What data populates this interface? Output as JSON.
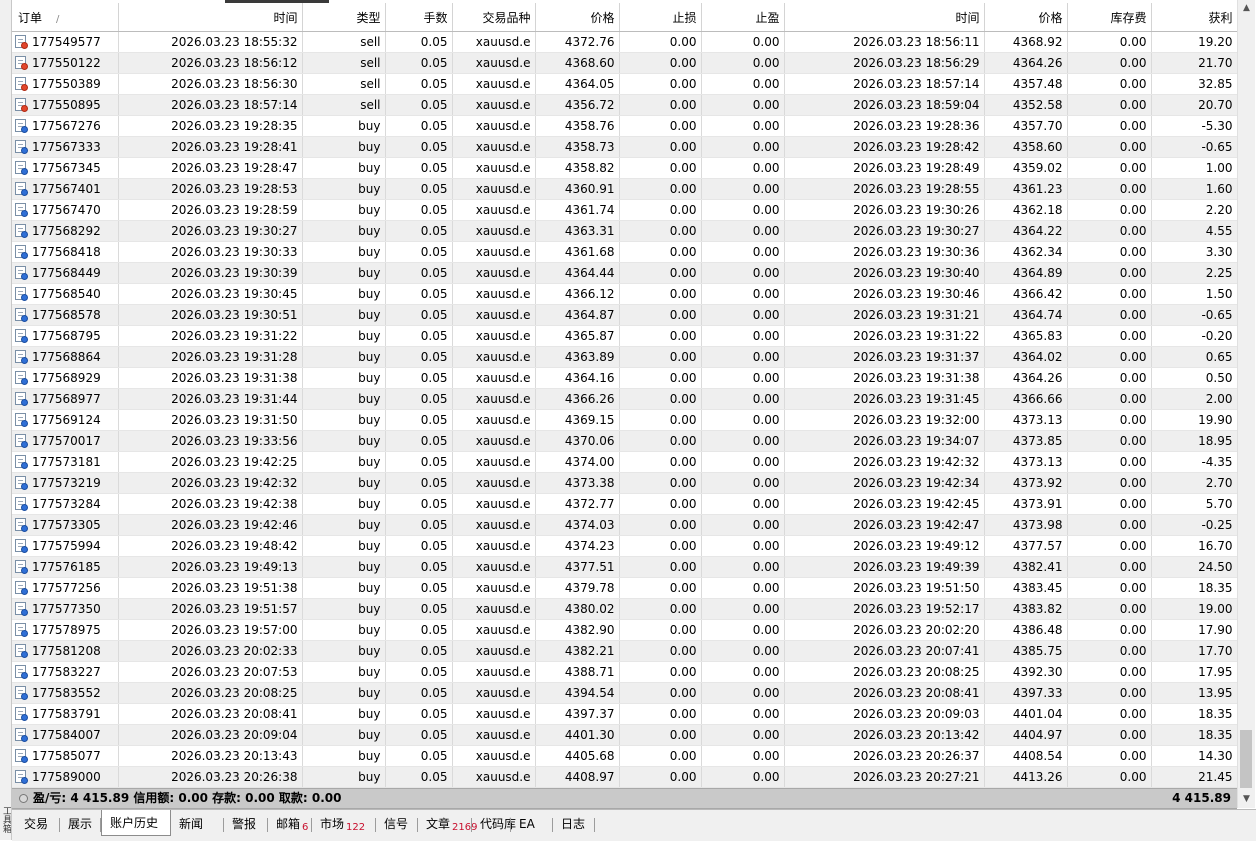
{
  "columns": [
    "订单",
    "时间",
    "类型",
    "手数",
    "交易品种",
    "价格",
    "止损",
    "止盈",
    "时间",
    "价格",
    "库存费",
    "获利"
  ],
  "sort_indicator": "/",
  "rows": [
    [
      "177549577",
      "2026.03.23 18:55:32",
      "sell",
      "0.05",
      "xauusd.e",
      "4372.76",
      "0.00",
      "0.00",
      "2026.03.23 18:56:11",
      "4368.92",
      "0.00",
      "19.20"
    ],
    [
      "177550122",
      "2026.03.23 18:56:12",
      "sell",
      "0.05",
      "xauusd.e",
      "4368.60",
      "0.00",
      "0.00",
      "2026.03.23 18:56:29",
      "4364.26",
      "0.00",
      "21.70"
    ],
    [
      "177550389",
      "2026.03.23 18:56:30",
      "sell",
      "0.05",
      "xauusd.e",
      "4364.05",
      "0.00",
      "0.00",
      "2026.03.23 18:57:14",
      "4357.48",
      "0.00",
      "32.85"
    ],
    [
      "177550895",
      "2026.03.23 18:57:14",
      "sell",
      "0.05",
      "xauusd.e",
      "4356.72",
      "0.00",
      "0.00",
      "2026.03.23 18:59:04",
      "4352.58",
      "0.00",
      "20.70"
    ],
    [
      "177567276",
      "2026.03.23 19:28:35",
      "buy",
      "0.05",
      "xauusd.e",
      "4358.76",
      "0.00",
      "0.00",
      "2026.03.23 19:28:36",
      "4357.70",
      "0.00",
      "-5.30"
    ],
    [
      "177567333",
      "2026.03.23 19:28:41",
      "buy",
      "0.05",
      "xauusd.e",
      "4358.73",
      "0.00",
      "0.00",
      "2026.03.23 19:28:42",
      "4358.60",
      "0.00",
      "-0.65"
    ],
    [
      "177567345",
      "2026.03.23 19:28:47",
      "buy",
      "0.05",
      "xauusd.e",
      "4358.82",
      "0.00",
      "0.00",
      "2026.03.23 19:28:49",
      "4359.02",
      "0.00",
      "1.00"
    ],
    [
      "177567401",
      "2026.03.23 19:28:53",
      "buy",
      "0.05",
      "xauusd.e",
      "4360.91",
      "0.00",
      "0.00",
      "2026.03.23 19:28:55",
      "4361.23",
      "0.00",
      "1.60"
    ],
    [
      "177567470",
      "2026.03.23 19:28:59",
      "buy",
      "0.05",
      "xauusd.e",
      "4361.74",
      "0.00",
      "0.00",
      "2026.03.23 19:30:26",
      "4362.18",
      "0.00",
      "2.20"
    ],
    [
      "177568292",
      "2026.03.23 19:30:27",
      "buy",
      "0.05",
      "xauusd.e",
      "4363.31",
      "0.00",
      "0.00",
      "2026.03.23 19:30:27",
      "4364.22",
      "0.00",
      "4.55"
    ],
    [
      "177568418",
      "2026.03.23 19:30:33",
      "buy",
      "0.05",
      "xauusd.e",
      "4361.68",
      "0.00",
      "0.00",
      "2026.03.23 19:30:36",
      "4362.34",
      "0.00",
      "3.30"
    ],
    [
      "177568449",
      "2026.03.23 19:30:39",
      "buy",
      "0.05",
      "xauusd.e",
      "4364.44",
      "0.00",
      "0.00",
      "2026.03.23 19:30:40",
      "4364.89",
      "0.00",
      "2.25"
    ],
    [
      "177568540",
      "2026.03.23 19:30:45",
      "buy",
      "0.05",
      "xauusd.e",
      "4366.12",
      "0.00",
      "0.00",
      "2026.03.23 19:30:46",
      "4366.42",
      "0.00",
      "1.50"
    ],
    [
      "177568578",
      "2026.03.23 19:30:51",
      "buy",
      "0.05",
      "xauusd.e",
      "4364.87",
      "0.00",
      "0.00",
      "2026.03.23 19:31:21",
      "4364.74",
      "0.00",
      "-0.65"
    ],
    [
      "177568795",
      "2026.03.23 19:31:22",
      "buy",
      "0.05",
      "xauusd.e",
      "4365.87",
      "0.00",
      "0.00",
      "2026.03.23 19:31:22",
      "4365.83",
      "0.00",
      "-0.20"
    ],
    [
      "177568864",
      "2026.03.23 19:31:28",
      "buy",
      "0.05",
      "xauusd.e",
      "4363.89",
      "0.00",
      "0.00",
      "2026.03.23 19:31:37",
      "4364.02",
      "0.00",
      "0.65"
    ],
    [
      "177568929",
      "2026.03.23 19:31:38",
      "buy",
      "0.05",
      "xauusd.e",
      "4364.16",
      "0.00",
      "0.00",
      "2026.03.23 19:31:38",
      "4364.26",
      "0.00",
      "0.50"
    ],
    [
      "177568977",
      "2026.03.23 19:31:44",
      "buy",
      "0.05",
      "xauusd.e",
      "4366.26",
      "0.00",
      "0.00",
      "2026.03.23 19:31:45",
      "4366.66",
      "0.00",
      "2.00"
    ],
    [
      "177569124",
      "2026.03.23 19:31:50",
      "buy",
      "0.05",
      "xauusd.e",
      "4369.15",
      "0.00",
      "0.00",
      "2026.03.23 19:32:00",
      "4373.13",
      "0.00",
      "19.90"
    ],
    [
      "177570017",
      "2026.03.23 19:33:56",
      "buy",
      "0.05",
      "xauusd.e",
      "4370.06",
      "0.00",
      "0.00",
      "2026.03.23 19:34:07",
      "4373.85",
      "0.00",
      "18.95"
    ],
    [
      "177573181",
      "2026.03.23 19:42:25",
      "buy",
      "0.05",
      "xauusd.e",
      "4374.00",
      "0.00",
      "0.00",
      "2026.03.23 19:42:32",
      "4373.13",
      "0.00",
      "-4.35"
    ],
    [
      "177573219",
      "2026.03.23 19:42:32",
      "buy",
      "0.05",
      "xauusd.e",
      "4373.38",
      "0.00",
      "0.00",
      "2026.03.23 19:42:34",
      "4373.92",
      "0.00",
      "2.70"
    ],
    [
      "177573284",
      "2026.03.23 19:42:38",
      "buy",
      "0.05",
      "xauusd.e",
      "4372.77",
      "0.00",
      "0.00",
      "2026.03.23 19:42:45",
      "4373.91",
      "0.00",
      "5.70"
    ],
    [
      "177573305",
      "2026.03.23 19:42:46",
      "buy",
      "0.05",
      "xauusd.e",
      "4374.03",
      "0.00",
      "0.00",
      "2026.03.23 19:42:47",
      "4373.98",
      "0.00",
      "-0.25"
    ],
    [
      "177575994",
      "2026.03.23 19:48:42",
      "buy",
      "0.05",
      "xauusd.e",
      "4374.23",
      "0.00",
      "0.00",
      "2026.03.23 19:49:12",
      "4377.57",
      "0.00",
      "16.70"
    ],
    [
      "177576185",
      "2026.03.23 19:49:13",
      "buy",
      "0.05",
      "xauusd.e",
      "4377.51",
      "0.00",
      "0.00",
      "2026.03.23 19:49:39",
      "4382.41",
      "0.00",
      "24.50"
    ],
    [
      "177577256",
      "2026.03.23 19:51:38",
      "buy",
      "0.05",
      "xauusd.e",
      "4379.78",
      "0.00",
      "0.00",
      "2026.03.23 19:51:50",
      "4383.45",
      "0.00",
      "18.35"
    ],
    [
      "177577350",
      "2026.03.23 19:51:57",
      "buy",
      "0.05",
      "xauusd.e",
      "4380.02",
      "0.00",
      "0.00",
      "2026.03.23 19:52:17",
      "4383.82",
      "0.00",
      "19.00"
    ],
    [
      "177578975",
      "2026.03.23 19:57:00",
      "buy",
      "0.05",
      "xauusd.e",
      "4382.90",
      "0.00",
      "0.00",
      "2026.03.23 20:02:20",
      "4386.48",
      "0.00",
      "17.90"
    ],
    [
      "177581208",
      "2026.03.23 20:02:33",
      "buy",
      "0.05",
      "xauusd.e",
      "4382.21",
      "0.00",
      "0.00",
      "2026.03.23 20:07:41",
      "4385.75",
      "0.00",
      "17.70"
    ],
    [
      "177583227",
      "2026.03.23 20:07:53",
      "buy",
      "0.05",
      "xauusd.e",
      "4388.71",
      "0.00",
      "0.00",
      "2026.03.23 20:08:25",
      "4392.30",
      "0.00",
      "17.95"
    ],
    [
      "177583552",
      "2026.03.23 20:08:25",
      "buy",
      "0.05",
      "xauusd.e",
      "4394.54",
      "0.00",
      "0.00",
      "2026.03.23 20:08:41",
      "4397.33",
      "0.00",
      "13.95"
    ],
    [
      "177583791",
      "2026.03.23 20:08:41",
      "buy",
      "0.05",
      "xauusd.e",
      "4397.37",
      "0.00",
      "0.00",
      "2026.03.23 20:09:03",
      "4401.04",
      "0.00",
      "18.35"
    ],
    [
      "177584007",
      "2026.03.23 20:09:04",
      "buy",
      "0.05",
      "xauusd.e",
      "4401.30",
      "0.00",
      "0.00",
      "2026.03.23 20:13:42",
      "4404.97",
      "0.00",
      "18.35"
    ],
    [
      "177585077",
      "2026.03.23 20:13:43",
      "buy",
      "0.05",
      "xauusd.e",
      "4405.68",
      "0.00",
      "0.00",
      "2026.03.23 20:26:37",
      "4408.54",
      "0.00",
      "14.30"
    ],
    [
      "177589000",
      "2026.03.23 20:26:38",
      "buy",
      "0.05",
      "xauusd.e",
      "4408.97",
      "0.00",
      "0.00",
      "2026.03.23 20:27:21",
      "4413.26",
      "0.00",
      "21.45"
    ]
  ],
  "summary": {
    "text": "盈/亏: 4 415.89  信用额: 0.00  存款: 0.00  取款: 0.00",
    "total": "4 415.89"
  },
  "tabs": [
    {
      "label": "交易",
      "badge": "",
      "active": false
    },
    {
      "label": "展示",
      "badge": "",
      "active": false
    },
    {
      "label": "账户历史",
      "badge": "",
      "active": true
    },
    {
      "label": "新闻",
      "badge": "",
      "active": false
    },
    {
      "label": "警报",
      "badge": "",
      "active": false
    },
    {
      "label": "邮箱",
      "badge": "6",
      "active": false
    },
    {
      "label": "市场",
      "badge": "122",
      "active": false
    },
    {
      "label": "信号",
      "badge": "",
      "active": false
    },
    {
      "label": "文章",
      "badge": "2169",
      "active": false
    },
    {
      "label": "代码库",
      "badge": "",
      "active": false
    },
    {
      "label": "EA",
      "badge": "",
      "active": false
    },
    {
      "label": "日志",
      "badge": "",
      "active": false
    }
  ],
  "left_strip_label": "工具箱",
  "colors": {
    "sell_dot": "#e2462c",
    "buy_dot": "#2f6fd6",
    "summary_bg": "#c9c9c9",
    "badge": "#c8102e"
  }
}
